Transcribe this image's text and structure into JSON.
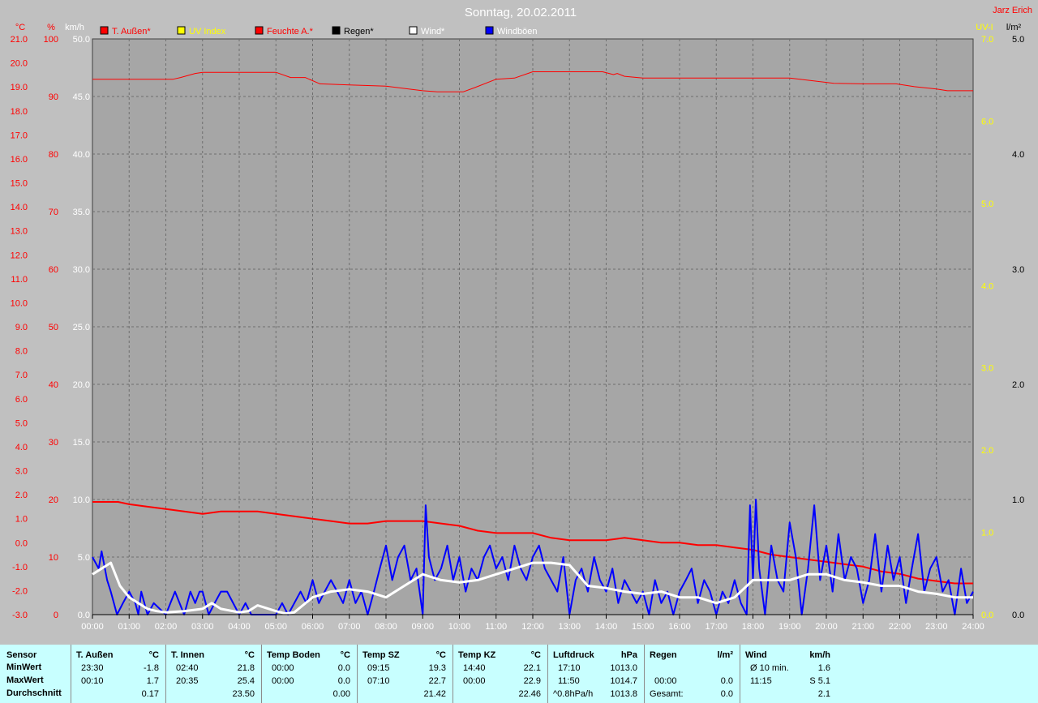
{
  "author": "Jarz Erich",
  "chart_data": {
    "type": "line",
    "title": "Sonntag, 20.02.2011",
    "x_ticks": [
      "00:00",
      "01:00",
      "02:00",
      "03:00",
      "04:00",
      "05:00",
      "06:00",
      "07:00",
      "08:00",
      "09:00",
      "10:00",
      "11:00",
      "12:00",
      "13:00",
      "14:00",
      "15:00",
      "16:00",
      "17:00",
      "18:00",
      "19:00",
      "20:00",
      "21:00",
      "22:00",
      "23:00",
      "24:00"
    ],
    "x_range_hours": [
      0,
      24
    ],
    "axes": {
      "temp_c": {
        "label": "°C",
        "color": "#ff0000",
        "range": [
          -3,
          21
        ],
        "ticks": [
          "21.0",
          "20.0",
          "19.0",
          "18.0",
          "17.0",
          "16.0",
          "15.0",
          "14.0",
          "13.0",
          "12.0",
          "11.0",
          "10.0",
          "9.0",
          "8.0",
          "7.0",
          "6.0",
          "5.0",
          "4.0",
          "3.0",
          "2.0",
          "1.0",
          "0.0",
          "-1.0",
          "-2.0",
          "-3.0"
        ]
      },
      "humidity": {
        "label": "%",
        "color": "#ff0000",
        "range": [
          0,
          100
        ],
        "ticks": [
          "100",
          "90",
          "80",
          "70",
          "60",
          "50",
          "40",
          "30",
          "20",
          "10",
          "0"
        ]
      },
      "wind_kmh": {
        "label": "km/h",
        "color": "#ffffff",
        "range": [
          0,
          50
        ],
        "ticks": [
          "50.0",
          "45.0",
          "40.0",
          "35.0",
          "30.0",
          "25.0",
          "20.0",
          "15.0",
          "10.0",
          "5.0",
          "0.0"
        ]
      },
      "uv": {
        "label": "UV-I",
        "color": "#ffff00",
        "range": [
          0,
          7
        ],
        "ticks": [
          "7.0",
          "6.0",
          "5.0",
          "4.0",
          "3.0",
          "2.0",
          "1.0",
          "0.0"
        ]
      },
      "rain": {
        "label": "l/m²",
        "color": "#000000",
        "range": [
          0,
          5
        ],
        "ticks": [
          "5.0",
          "4.0",
          "3.0",
          "2.0",
          "1.0",
          "0.0"
        ]
      }
    },
    "grid": true,
    "legend_position": "top",
    "legend": [
      {
        "name": "T. Außen*",
        "color": "#ff0000",
        "text_color": "#ff0000"
      },
      {
        "name": "UV Index",
        "color": "#ffff00",
        "text_color": "#ffff00"
      },
      {
        "name": "Feuchte A.*",
        "color": "#ff0000",
        "text_color": "#ff0000"
      },
      {
        "name": "Regen*",
        "color": "#000000",
        "text_color": "#000000"
      },
      {
        "name": "Wind*",
        "color": "#ffffff",
        "text_color": "#ffffff"
      },
      {
        "name": "Windböen",
        "color": "#0000ff",
        "text_color": "#ffffff"
      }
    ],
    "series": [
      {
        "name": "Feuchte A.*",
        "axis": "humidity",
        "color": "#ff0000",
        "width": 1,
        "x": [
          0,
          1.4,
          2.2,
          2.4,
          2.8,
          3,
          4,
          5,
          5.4,
          5.8,
          6.2,
          7,
          8,
          9,
          9.4,
          10.1,
          10.4,
          11,
          11.5,
          12,
          12.8,
          13.9,
          14.2,
          14.3,
          14.5,
          15,
          15.8,
          16.5,
          18,
          19,
          20.2,
          21,
          21.9,
          22.4,
          23,
          23.3,
          24
        ],
        "y": [
          93,
          93,
          93,
          93.3,
          94,
          94.2,
          94.2,
          94.2,
          93.3,
          93.3,
          92.2,
          92,
          91.8,
          91,
          90.8,
          90.8,
          91.5,
          93,
          93.2,
          94.3,
          94.3,
          94.3,
          93.8,
          94,
          93.5,
          93.2,
          93.2,
          93.2,
          93.2,
          93.2,
          92.3,
          92.2,
          92.2,
          91.7,
          91.3,
          91,
          91
        ]
      },
      {
        "name": "T. Außen*",
        "axis": "temp_c",
        "color": "#ff0000",
        "width": 2,
        "x": [
          0,
          0.3,
          0.7,
          1,
          1.5,
          2,
          2.5,
          3,
          3.5,
          4,
          4.5,
          5,
          5.5,
          6,
          6.5,
          7,
          7.5,
          8,
          8.5,
          9,
          9.5,
          10,
          10.5,
          11,
          11.5,
          12,
          12.5,
          13,
          13.5,
          14,
          14.5,
          15,
          15.5,
          16,
          16.5,
          17,
          17.5,
          18,
          18.5,
          19,
          19.5,
          20,
          20.5,
          21,
          21.5,
          22,
          22.5,
          23,
          23.5,
          24
        ],
        "y": [
          1.7,
          1.7,
          1.7,
          1.6,
          1.5,
          1.4,
          1.3,
          1.2,
          1.3,
          1.3,
          1.3,
          1.2,
          1.1,
          1.0,
          0.9,
          0.8,
          0.8,
          0.9,
          0.9,
          0.9,
          0.8,
          0.7,
          0.5,
          0.4,
          0.4,
          0.4,
          0.2,
          0.1,
          0.1,
          0.1,
          0.2,
          0.1,
          0.0,
          0.0,
          -0.1,
          -0.1,
          -0.2,
          -0.3,
          -0.5,
          -0.6,
          -0.7,
          -0.8,
          -0.9,
          -1.0,
          -1.2,
          -1.3,
          -1.5,
          -1.6,
          -1.7,
          -1.7
        ]
      },
      {
        "name": "UV Index",
        "axis": "uv",
        "color": "#ffff00",
        "width": 1,
        "x": [
          0,
          24
        ],
        "y": [
          0,
          0
        ]
      },
      {
        "name": "Windböen",
        "axis": "wind_kmh",
        "color": "#0000ff",
        "width": 2,
        "x": [
          0,
          0.17,
          0.25,
          0.4,
          0.5,
          0.67,
          0.83,
          1.0,
          1.17,
          1.25,
          1.33,
          1.5,
          1.67,
          2.0,
          2.25,
          2.5,
          2.67,
          2.8,
          2.92,
          3.0,
          3.17,
          3.33,
          3.5,
          3.67,
          4.0,
          4.17,
          4.33,
          4.67,
          5.0,
          5.17,
          5.33,
          5.5,
          5.67,
          5.83,
          6.0,
          6.17,
          6.33,
          6.5,
          6.67,
          6.83,
          7.0,
          7.17,
          7.33,
          7.5,
          7.67,
          7.83,
          8.0,
          8.17,
          8.33,
          8.5,
          8.67,
          8.83,
          9.0,
          9.08,
          9.17,
          9.33,
          9.5,
          9.67,
          9.83,
          10.0,
          10.17,
          10.33,
          10.5,
          10.67,
          10.83,
          11.0,
          11.17,
          11.33,
          11.5,
          11.67,
          11.83,
          12.0,
          12.17,
          12.33,
          12.5,
          12.67,
          12.83,
          13.0,
          13.17,
          13.33,
          13.5,
          13.67,
          13.83,
          14.0,
          14.17,
          14.33,
          14.5,
          14.67,
          14.83,
          15.0,
          15.17,
          15.33,
          15.5,
          15.67,
          15.83,
          16.0,
          16.17,
          16.33,
          16.5,
          16.67,
          16.83,
          17.0,
          17.17,
          17.33,
          17.5,
          17.67,
          17.83,
          17.92,
          18.0,
          18.08,
          18.17,
          18.33,
          18.5,
          18.67,
          18.83,
          19.0,
          19.17,
          19.33,
          19.5,
          19.67,
          19.83,
          20.0,
          20.17,
          20.33,
          20.5,
          20.67,
          20.83,
          21.0,
          21.17,
          21.33,
          21.5,
          21.67,
          21.83,
          22.0,
          22.17,
          22.33,
          22.5,
          22.67,
          22.83,
          23.0,
          23.17,
          23.33,
          23.5,
          23.67,
          23.83,
          24.0
        ],
        "y": [
          5,
          4,
          5.5,
          3,
          2,
          0,
          1,
          2,
          1,
          0,
          2,
          0,
          1,
          0,
          2,
          0,
          2,
          1,
          2,
          2,
          0,
          1,
          2,
          2,
          0,
          1,
          0,
          0,
          0,
          1,
          0,
          1,
          2,
          1,
          3,
          1,
          2,
          3,
          2,
          1,
          3,
          1,
          2,
          0,
          2,
          4,
          6,
          3,
          5,
          6,
          3,
          4,
          0,
          9.5,
          5,
          3,
          4,
          6,
          3,
          5,
          2,
          4,
          3,
          5,
          6,
          4,
          5,
          3,
          6,
          4,
          3,
          5,
          6,
          4,
          3,
          2,
          5,
          0,
          3,
          4,
          2,
          5,
          3,
          2,
          4,
          1,
          3,
          2,
          1,
          2,
          0,
          3,
          1,
          2,
          0,
          2,
          3,
          4,
          1,
          3,
          2,
          0,
          2,
          1,
          3,
          1,
          0,
          9.5,
          3,
          10,
          4,
          0,
          6,
          3,
          2,
          8,
          5,
          0,
          4,
          9.5,
          3,
          6,
          2,
          7,
          3,
          5,
          4,
          1,
          3,
          7,
          2,
          6,
          3,
          5,
          1,
          4,
          7,
          2,
          4,
          5,
          2,
          3,
          0,
          4,
          1,
          2
        ]
      },
      {
        "name": "Wind*",
        "axis": "wind_kmh",
        "color": "#ffffff",
        "width": 3,
        "x": [
          0,
          0.25,
          0.5,
          0.75,
          1.0,
          1.25,
          1.5,
          1.75,
          2.0,
          2.5,
          3.0,
          3.25,
          3.5,
          4.0,
          4.25,
          4.5,
          5.0,
          5.25,
          5.5,
          6.0,
          6.5,
          7.0,
          7.5,
          8.0,
          8.5,
          9.0,
          9.5,
          10.0,
          10.5,
          11.0,
          11.5,
          12.0,
          12.5,
          13.0,
          13.5,
          14.0,
          14.5,
          15.0,
          15.5,
          16.0,
          16.5,
          17.0,
          17.5,
          18.0,
          18.5,
          19.0,
          19.5,
          20.0,
          20.5,
          21.0,
          21.5,
          22.0,
          22.5,
          23.0,
          23.5,
          24.0
        ],
        "y": [
          3.5,
          4.0,
          4.5,
          2.5,
          1.5,
          1.0,
          0.5,
          0.3,
          0.2,
          0.3,
          0.5,
          1.0,
          0.5,
          0.2,
          0.3,
          0.8,
          0.3,
          0.1,
          0.2,
          1.5,
          2.0,
          2.2,
          2.0,
          1.5,
          2.5,
          3.5,
          3.0,
          2.8,
          3.0,
          3.5,
          4.0,
          4.5,
          4.5,
          4.3,
          2.5,
          2.3,
          2.0,
          1.8,
          2.0,
          1.5,
          1.5,
          1.0,
          1.5,
          3.0,
          3.0,
          3.0,
          3.5,
          3.5,
          3.0,
          2.8,
          2.5,
          2.5,
          2.0,
          1.8,
          1.5,
          1.5
        ]
      }
    ]
  },
  "table": {
    "columns": [
      {
        "header": "Sensor",
        "unit": "",
        "min_time": "MinWert",
        "min_value": "",
        "max_time": "MaxWert",
        "max_value": "",
        "avg_time": "Durchschnitt",
        "avg_value": ""
      },
      {
        "header": "T. Außen",
        "unit": "°C",
        "min_time": "23:30",
        "min_value": "-1.8",
        "max_time": "00:10",
        "max_value": "1.7",
        "avg_time": "",
        "avg_value": "0.17"
      },
      {
        "header": "T. Innen",
        "unit": "°C",
        "min_time": "02:40",
        "min_value": "21.8",
        "max_time": "20:35",
        "max_value": "25.4",
        "avg_time": "",
        "avg_value": "23.50"
      },
      {
        "header": "Temp Boden",
        "unit": "°C",
        "min_time": "00:00",
        "min_value": "0.0",
        "max_time": "00:00",
        "max_value": "0.0",
        "avg_time": "",
        "avg_value": "0.00"
      },
      {
        "header": "Temp SZ",
        "unit": "°C",
        "min_time": "09:15",
        "min_value": "19.3",
        "max_time": "07:10",
        "max_value": "22.7",
        "avg_time": "",
        "avg_value": "21.42"
      },
      {
        "header": "Temp KZ",
        "unit": "°C",
        "min_time": "14:40",
        "min_value": "22.1",
        "max_time": "00:00",
        "max_value": "22.9",
        "avg_time": "",
        "avg_value": "22.46"
      },
      {
        "header": "Luftdruck",
        "unit": "hPa",
        "min_time": "17:10",
        "min_value": "1013.0",
        "max_time": "11:50",
        "max_value": "1014.7",
        "avg_time": "^0.8hPa/h",
        "avg_value": "1013.8"
      },
      {
        "header": "Regen",
        "unit": "l/m²",
        "min_time": "",
        "min_value": "",
        "max_time": "00:00",
        "max_value": "0.0",
        "avg_time": "Gesamt:",
        "avg_value": "0.0"
      },
      {
        "header": "Wind",
        "unit": "km/h",
        "min_time": "Ø 10 min.",
        "min_value": "1.6",
        "max_time": "11:15",
        "max_value": "S 5.1",
        "avg_time": "",
        "avg_value": "2.1"
      }
    ]
  }
}
